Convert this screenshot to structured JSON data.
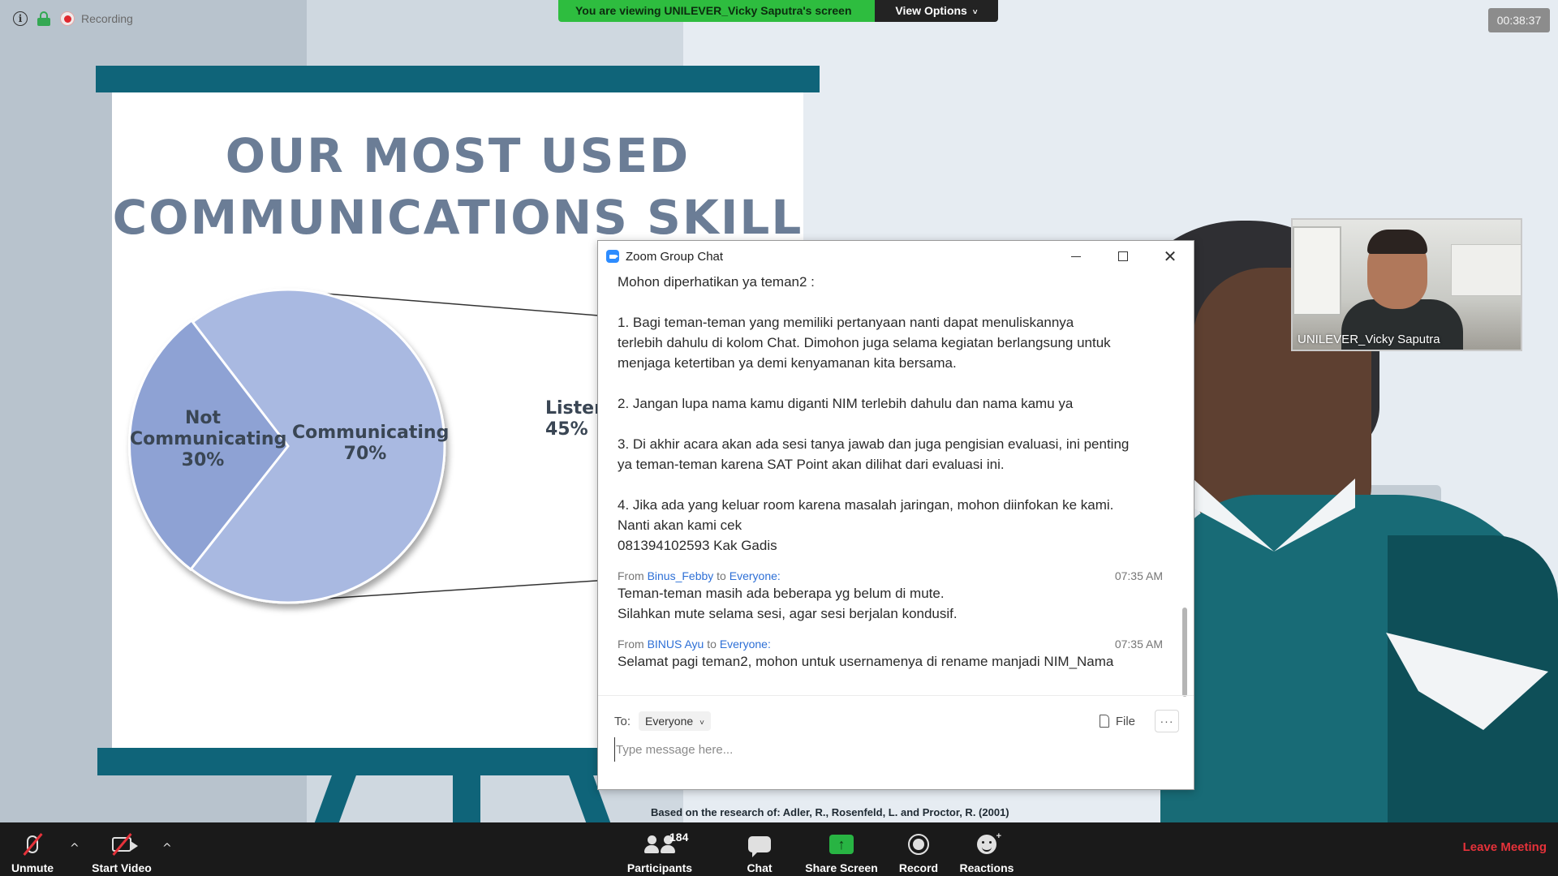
{
  "top_bar": {
    "recording_label": "Recording",
    "viewing_text": "You are viewing UNILEVER_Vicky Saputra's screen",
    "view_options_label": "View Options",
    "timer": "00:38:37"
  },
  "slide": {
    "title_line1": "OUR MOST USED",
    "title_line2": "COMMUNICATIONS SKILL",
    "pie_not_line1": "Not",
    "pie_not_line2": "Communicating",
    "pie_not_pct": "30%",
    "pie_comm_label": "Communicating",
    "pie_comm_pct": "70%",
    "pie2_label": "Listen",
    "pie2_pct": "45%",
    "research_note": "Based on the research of: Adler, R., Rosenfeld, L. and Proctor, R. (2001)",
    "colors": {
      "dark_slice": "#8ea2d4",
      "light_slice": "#a9b9e1",
      "board": "#0f6479"
    }
  },
  "video": {
    "participant_name": "UNILEVER_Vicky Saputra"
  },
  "chat": {
    "window_title": "Zoom Group Chat",
    "messages": [
      {
        "text": "Mohon diperhatikan ya teman2 :\n\n1. Bagi teman-teman yang memiliki pertanyaan nanti dapat menuliskannya\nterlebih dahulu di kolom Chat. Dimohon juga selama kegiatan berlangsung untuk\nmenjaga ketertiban ya demi kenyamanan kita bersama.\n\n2. Jangan lupa nama kamu diganti NIM terlebih dahulu dan nama kamu ya\n\n3. Di akhir acara akan ada sesi tanya jawab dan juga pengisian evaluasi, ini penting\nya teman-teman karena SAT Point akan dilihat dari evaluasi ini.\n\n4. Jika ada yang keluar room karena masalah jaringan, mohon diinfokan ke kami.\nNanti akan kami cek\n081394102593 Kak Gadis"
      },
      {
        "from_prefix": "From",
        "sender": "Binus_Febby",
        "to_word": "to",
        "recipient": "Everyone:",
        "time": "07:35 AM",
        "text": "Teman-teman masih ada beberapa yg belum di mute.\nSilahkan mute selama sesi, agar sesi berjalan kondusif."
      },
      {
        "from_prefix": "From",
        "sender": "BINUS Ayu",
        "to_word": "to",
        "recipient": "Everyone:",
        "time": "07:35 AM",
        "text": "Selamat pagi teman2, mohon untuk usernamenya di rename manjadi NIM_Nama"
      }
    ],
    "to_label": "To:",
    "to_value": "Everyone",
    "file_label": "File",
    "more_label": "···",
    "input_placeholder": "Type message here..."
  },
  "toolbar": {
    "unmute_label": "Unmute",
    "start_video_label": "Start Video",
    "participants_label": "Participants",
    "participants_count": "184",
    "chat_label": "Chat",
    "share_screen_label": "Share Screen",
    "record_label": "Record",
    "reactions_label": "Reactions",
    "leave_label": "Leave Meeting",
    "caret_glyph": "^",
    "share_glyph": "↑",
    "reactions_plus": "+"
  }
}
